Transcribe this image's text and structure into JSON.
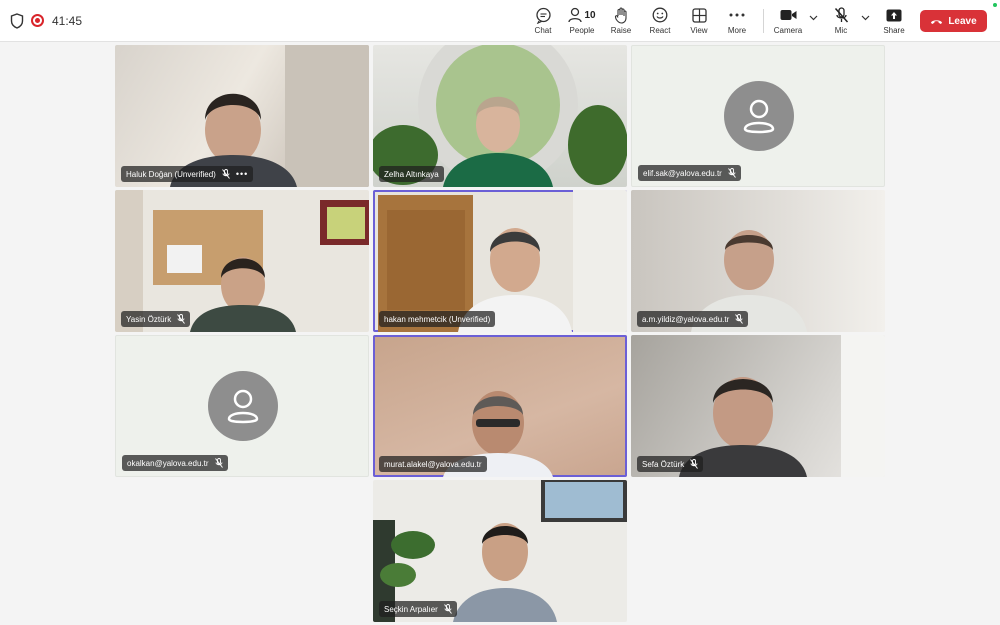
{
  "topbar": {
    "timer": "41:45",
    "buttons": {
      "chat": "Chat",
      "people": "People",
      "people_count": "10",
      "raise": "Raise",
      "react": "React",
      "view": "View",
      "more": "More",
      "camera": "Camera",
      "mic": "Mic",
      "share": "Share"
    },
    "leave": "Leave",
    "accent_colors": {
      "leave": "#d93238",
      "record": "#d9252b",
      "active_speaker": "#6b5fd6"
    }
  },
  "participants": [
    {
      "name": "Haluk Doğan (Unverified)",
      "muted": true,
      "has_more": true
    },
    {
      "name": "Zelha Altınkaya",
      "muted": false
    },
    {
      "name": "elif.sak@yalova.edu.tr",
      "muted": true,
      "avatar": "person-icon"
    },
    {
      "name": "Yasin Öztürk",
      "muted": true
    },
    {
      "name": "hakan mehmetcik (Unverified)",
      "muted": false,
      "active": true
    },
    {
      "name": "a.m.yildiz@yalova.edu.tr",
      "muted": true
    },
    {
      "name": "okalkan@yalova.edu.tr",
      "muted": true,
      "avatar": "person-icon"
    },
    {
      "name": "murat.alakel@yalova.edu.tr",
      "muted": false,
      "active": true
    },
    {
      "name": "Sefa Öztürk",
      "muted": true
    },
    {
      "name": "Seçkin Arpalıer",
      "muted": true
    }
  ]
}
